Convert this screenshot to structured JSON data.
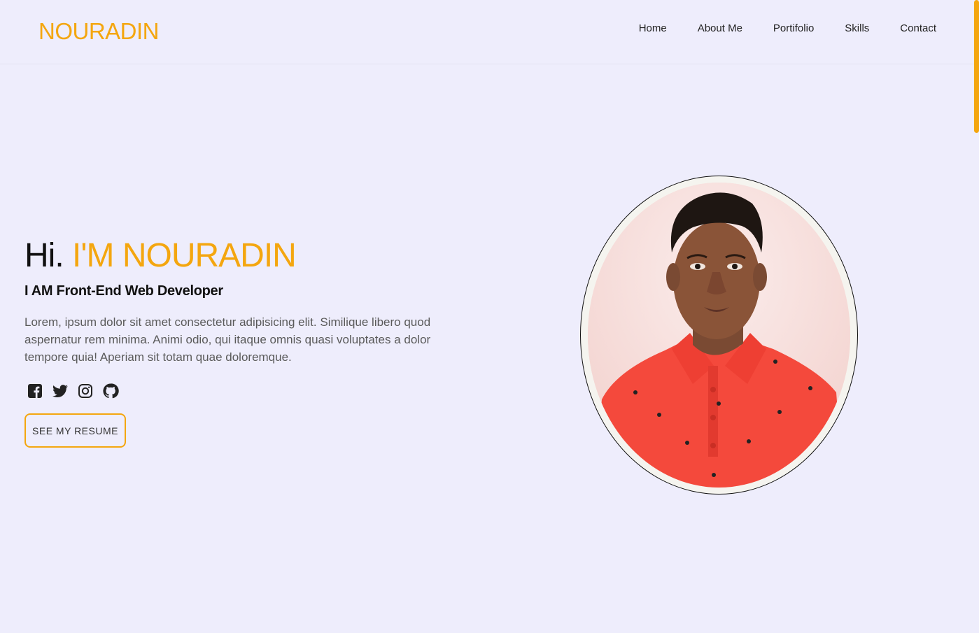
{
  "header": {
    "logo": "NOURADIN",
    "nav": [
      "Home",
      "About Me",
      "Portifolio",
      "Skills",
      "Contact"
    ]
  },
  "hero": {
    "greeting": "Hi.",
    "name": "I'M NOURADIN",
    "subtitle": "I AM Front-End Web Developer",
    "description": "Lorem, ipsum dolor sit amet consectetur adipisicing elit. Similique libero quod aspernatur rem minima. Animi odio, qui itaque omnis quasi voluptates a dolor tempore quia! Aperiam sit totam quae doloremque.",
    "socials": [
      "facebook-icon",
      "twitter-icon",
      "instagram-icon",
      "github-icon"
    ],
    "resume_button": "SEE MY RESUME"
  },
  "colors": {
    "accent": "#f4a60f",
    "background": "#eeedfc",
    "shirt": "#f4493c"
  }
}
